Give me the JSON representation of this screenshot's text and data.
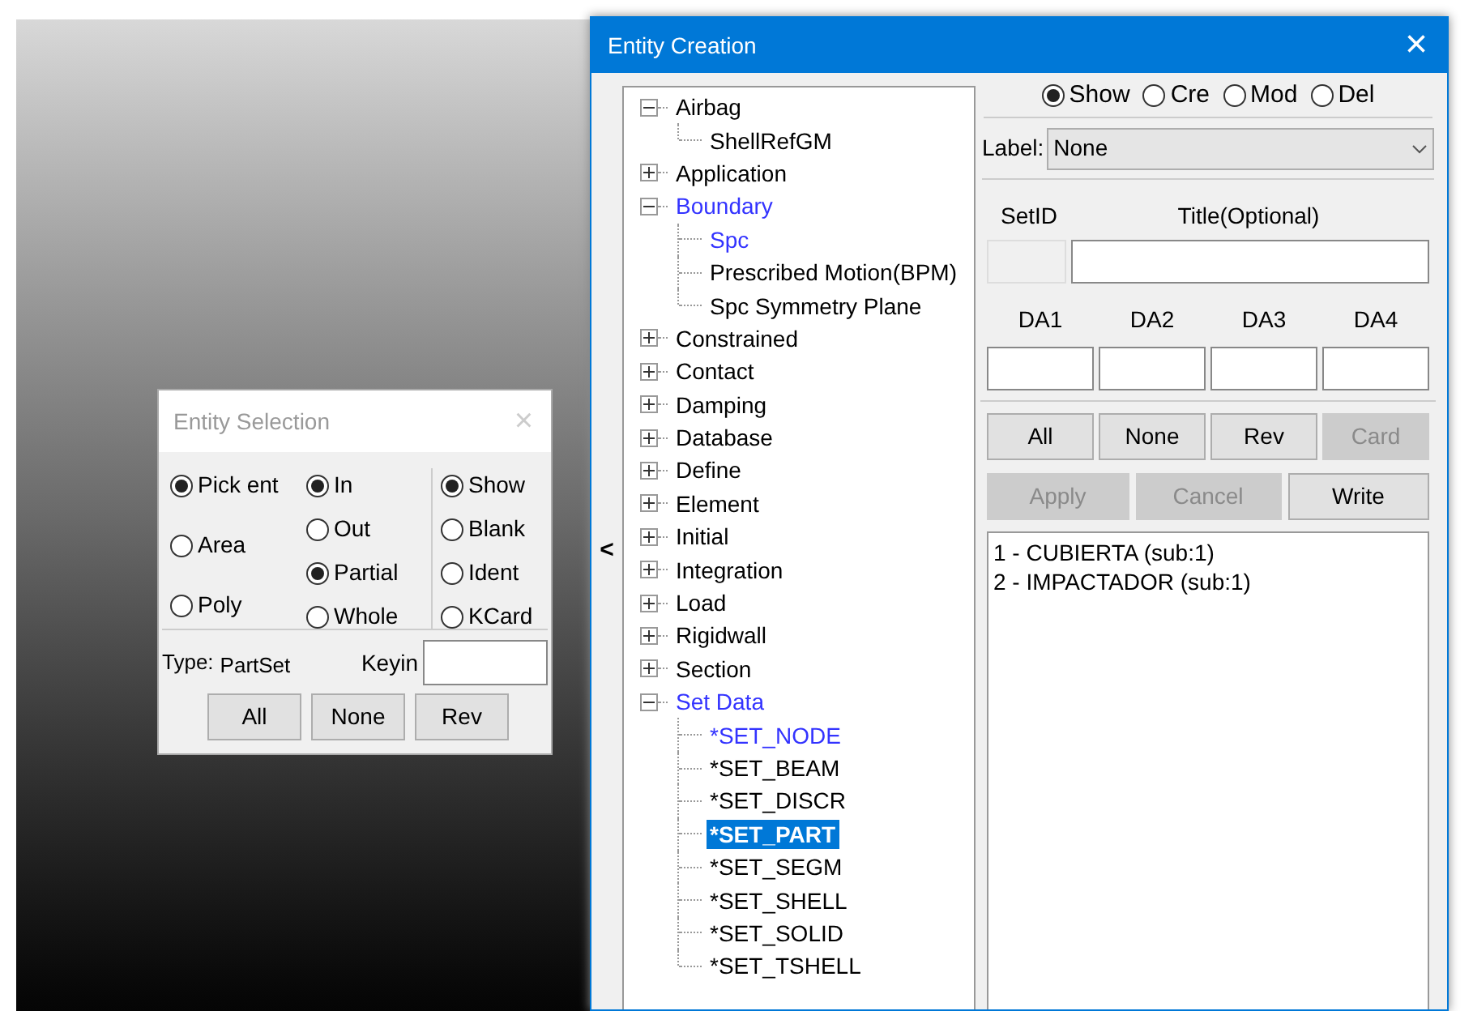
{
  "selection_dialog": {
    "title": "Entity Selection",
    "close": "×",
    "pick_modes": [
      {
        "label": "Pick ent",
        "selected": true
      },
      {
        "label": "Area",
        "selected": false
      },
      {
        "label": "Poly",
        "selected": false
      }
    ],
    "region_modes": [
      {
        "label": "In",
        "selected": true
      },
      {
        "label": "Out",
        "selected": false
      },
      {
        "label": "Partial",
        "selected": true
      },
      {
        "label": "Whole",
        "selected": false
      }
    ],
    "actions": [
      {
        "label": "Show",
        "selected": true
      },
      {
        "label": "Blank",
        "selected": false
      },
      {
        "label": "Ident",
        "selected": false
      },
      {
        "label": "KCard",
        "selected": false
      }
    ],
    "type_label": "Type:",
    "type_value": "PartSet",
    "keyin_label": "Keyin",
    "buttons": [
      "All",
      "None",
      "Rev"
    ]
  },
  "creation_window": {
    "title": "Entity Creation",
    "close": "×",
    "collapse_arrow": "<",
    "tree": [
      {
        "label": "Airbag",
        "expanded": true,
        "highlighted": false,
        "selected": false,
        "children": [
          {
            "label": "ShellRefGM",
            "highlighted": false,
            "selected": false
          }
        ]
      },
      {
        "label": "Application",
        "expanded": false,
        "highlighted": false,
        "selected": false
      },
      {
        "label": "Boundary",
        "expanded": true,
        "highlighted": true,
        "selected": false,
        "children": [
          {
            "label": "Spc",
            "highlighted": true,
            "selected": false
          },
          {
            "label": "Prescribed Motion(BPM)",
            "highlighted": false,
            "selected": false
          },
          {
            "label": "Spc Symmetry Plane",
            "highlighted": false,
            "selected": false
          }
        ]
      },
      {
        "label": "Constrained",
        "expanded": false,
        "highlighted": false,
        "selected": false
      },
      {
        "label": "Contact",
        "expanded": false,
        "highlighted": false,
        "selected": false
      },
      {
        "label": "Damping",
        "expanded": false,
        "highlighted": false,
        "selected": false
      },
      {
        "label": "Database",
        "expanded": false,
        "highlighted": false,
        "selected": false
      },
      {
        "label": "Define",
        "expanded": false,
        "highlighted": false,
        "selected": false
      },
      {
        "label": "Element",
        "expanded": false,
        "highlighted": false,
        "selected": false
      },
      {
        "label": "Initial",
        "expanded": false,
        "highlighted": false,
        "selected": false
      },
      {
        "label": "Integration",
        "expanded": false,
        "highlighted": false,
        "selected": false
      },
      {
        "label": "Load",
        "expanded": false,
        "highlighted": false,
        "selected": false
      },
      {
        "label": "Rigidwall",
        "expanded": false,
        "highlighted": false,
        "selected": false
      },
      {
        "label": "Section",
        "expanded": false,
        "highlighted": false,
        "selected": false
      },
      {
        "label": "Set Data",
        "expanded": true,
        "highlighted": true,
        "selected": false,
        "children": [
          {
            "label": "*SET_NODE",
            "highlighted": true,
            "selected": false
          },
          {
            "label": "*SET_BEAM",
            "highlighted": false,
            "selected": false
          },
          {
            "label": "*SET_DISCR",
            "highlighted": false,
            "selected": false
          },
          {
            "label": "*SET_PART",
            "highlighted": false,
            "selected": true
          },
          {
            "label": "*SET_SEGM",
            "highlighted": false,
            "selected": false
          },
          {
            "label": "*SET_SHELL",
            "highlighted": false,
            "selected": false
          },
          {
            "label": "*SET_SOLID",
            "highlighted": false,
            "selected": false
          },
          {
            "label": "*SET_TSHELL",
            "highlighted": false,
            "selected": false
          }
        ]
      }
    ],
    "modes": [
      {
        "label": "Show",
        "selected": true
      },
      {
        "label": "Cre",
        "selected": false
      },
      {
        "label": "Mod",
        "selected": false
      },
      {
        "label": "Del",
        "selected": false
      }
    ],
    "label_field": {
      "label": "Label:",
      "value": "None"
    },
    "setid_label": "SetID",
    "title_label": "Title(Optional)",
    "setid_disabled": true,
    "da_labels": [
      "DA1",
      "DA2",
      "DA3",
      "DA4"
    ],
    "buttons_row1": [
      {
        "label": "All",
        "disabled": false
      },
      {
        "label": "None",
        "disabled": false
      },
      {
        "label": "Rev",
        "disabled": false
      },
      {
        "label": "Card",
        "disabled": true
      }
    ],
    "buttons_row2": [
      {
        "label": "Apply",
        "disabled": true
      },
      {
        "label": "Cancel",
        "disabled": true
      },
      {
        "label": "Write",
        "disabled": false
      }
    ],
    "list": [
      "1 - CUBIERTA (sub:1)",
      "2 - IMPACTADOR (sub:1)"
    ]
  }
}
